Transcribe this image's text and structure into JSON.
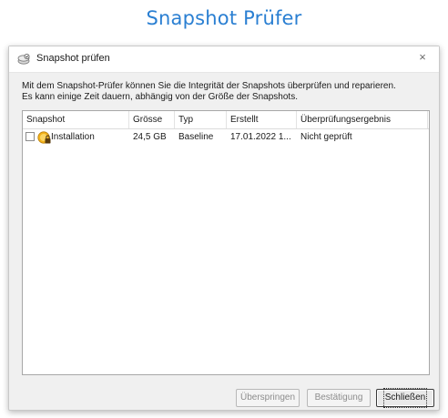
{
  "page_title": "Snapshot Prüfer",
  "window": {
    "title": "Snapshot prüfen",
    "close_glyph": "×"
  },
  "description": {
    "line1": "Mit dem Snapshot-Prüfer können Sie die Integrität der Snapshots überprüfen und reparieren.",
    "line2": "Es kann einige Zeit dauern, abhängig von der Größe der Snapshots."
  },
  "table": {
    "columns": [
      "Snapshot",
      "Grösse",
      "Typ",
      "Erstellt",
      "Überprüfungsergebnis"
    ],
    "rows": [
      {
        "checked": false,
        "icon": "snapshot-lock-icon",
        "name": "Installation",
        "size": "24,5 GB",
        "type": "Baseline",
        "created": "17.01.2022 1...",
        "result": "Nicht geprüft"
      }
    ]
  },
  "buttons": {
    "skip": "Überspringen",
    "confirm": "Bestätigung",
    "close": "Schließen"
  },
  "colors": {
    "title_blue": "#2a7fd2",
    "dialog_bg": "#f0f0f0",
    "disabled_text": "#8d8d8d"
  }
}
